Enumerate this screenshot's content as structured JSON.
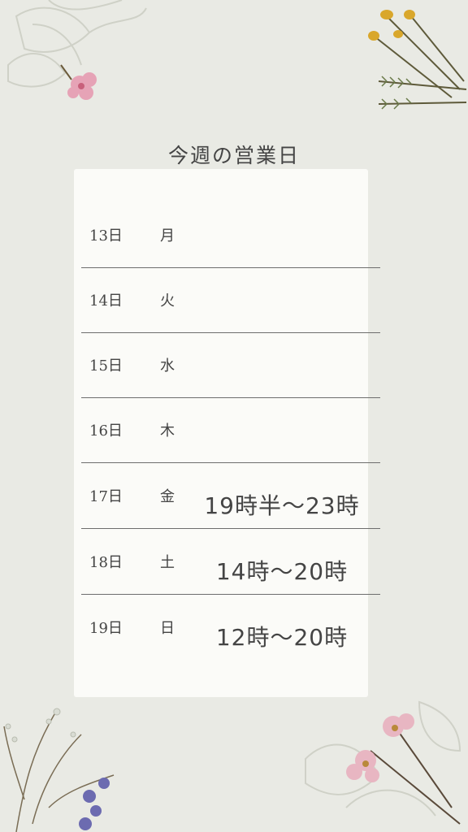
{
  "title": "今週の営業日",
  "schedule": [
    {
      "date": "13日",
      "dow": "月",
      "hours": ""
    },
    {
      "date": "14日",
      "dow": "火",
      "hours": ""
    },
    {
      "date": "15日",
      "dow": "水",
      "hours": ""
    },
    {
      "date": "16日",
      "dow": "木",
      "hours": ""
    },
    {
      "date": "17日",
      "dow": "金",
      "hours": "19時半～23時"
    },
    {
      "date": "18日",
      "dow": "土",
      "hours": "14時～20時"
    },
    {
      "date": "19日",
      "dow": "日",
      "hours": "12時～20時"
    }
  ],
  "colors": {
    "background": "#e9eae4",
    "card": "#fbfbf8",
    "text": "#444444",
    "divider": "#6d6d6d"
  },
  "decorations": [
    "pink-flower-icon",
    "yellow-wildflower-icon",
    "purple-flower-icon",
    "pink-blossom-icon"
  ]
}
